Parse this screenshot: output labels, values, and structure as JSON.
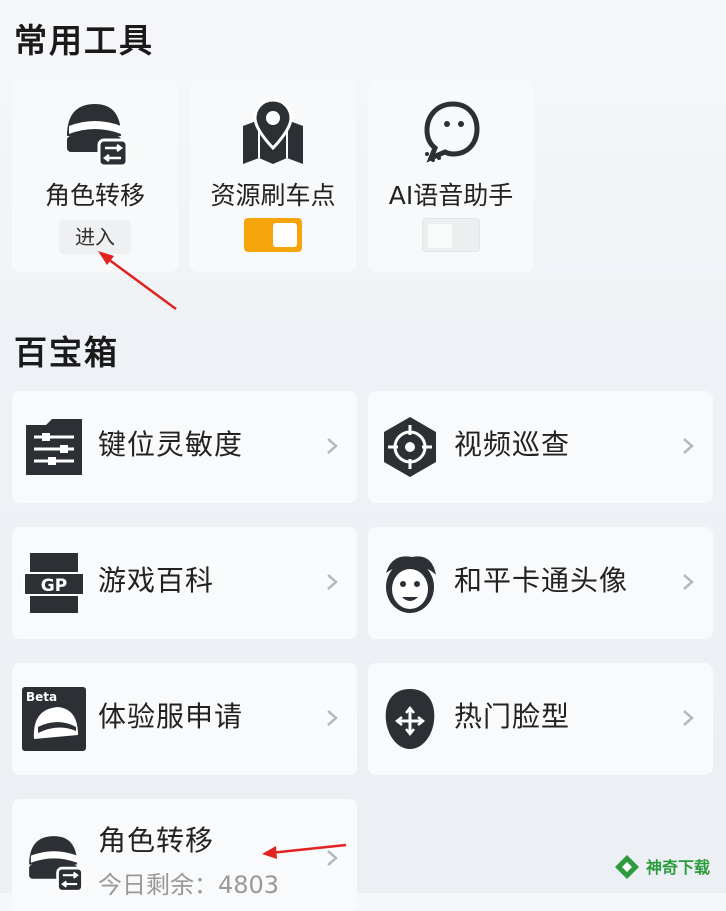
{
  "sections": {
    "tools_title": "常用工具",
    "box_title": "百宝箱"
  },
  "tools": [
    {
      "label": "角色转移",
      "action": "进入",
      "icon": "helmet-swap-icon"
    },
    {
      "label": "资源刷车点",
      "toggle": "on",
      "icon": "map-pin-icon"
    },
    {
      "label": "AI语音助手",
      "toggle": "off",
      "icon": "voice-bubble-icon"
    }
  ],
  "box_items": [
    {
      "label": "键位灵敏度",
      "icon": "sliders-icon"
    },
    {
      "label": "视频巡查",
      "icon": "crosshair-icon"
    },
    {
      "label": "游戏百科",
      "icon": "gp-card-icon"
    },
    {
      "label": "和平卡通头像",
      "icon": "cartoon-face-icon"
    },
    {
      "label": "体验服申请",
      "icon": "beta-helmet-icon"
    },
    {
      "label": "热门脸型",
      "icon": "face-move-icon"
    },
    {
      "label": "角色转移",
      "sub": "今日剩余：4803",
      "icon": "helmet-swap-icon"
    }
  ],
  "colors": {
    "toggle_on": "#f6a40c",
    "arrow": "#e0231f",
    "watermark": "#2b9b3c"
  },
  "watermark": {
    "text": "神奇下载"
  }
}
